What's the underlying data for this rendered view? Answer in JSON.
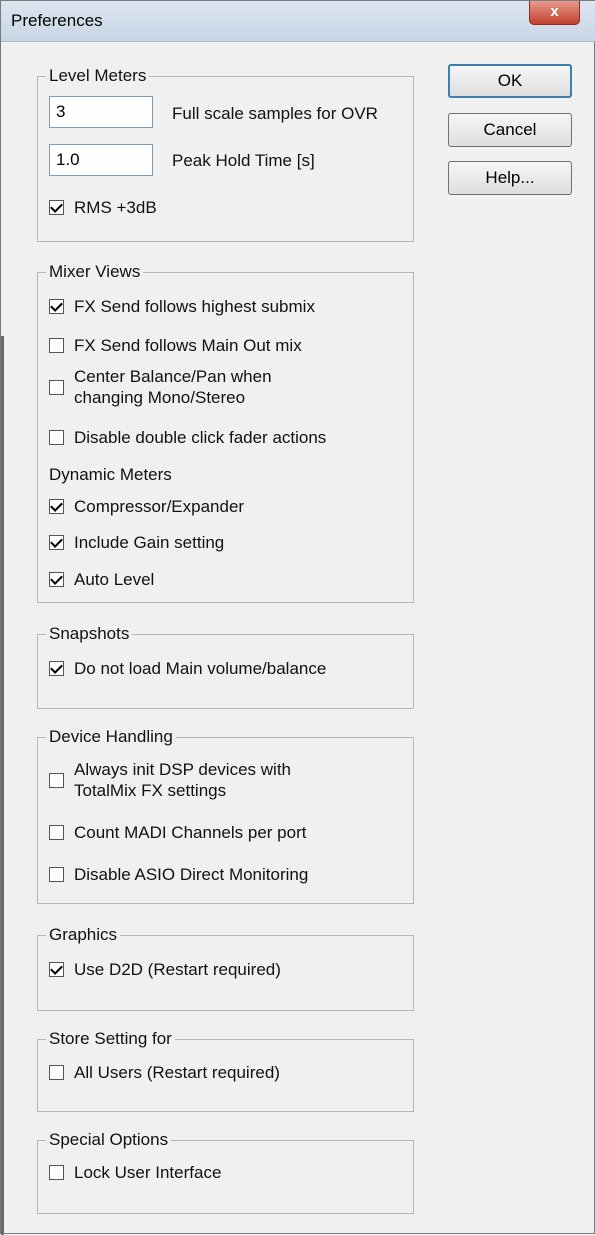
{
  "window": {
    "title": "Preferences",
    "close_symbol": "x"
  },
  "buttons": {
    "ok": "OK",
    "cancel": "Cancel",
    "help": "Help..."
  },
  "level_meters": {
    "legend": "Level Meters",
    "ovr_value": "3",
    "ovr_label": "Full scale samples for OVR",
    "peak_value": "1.0",
    "peak_label": "Peak Hold Time [s]",
    "rms_label": "RMS +3dB",
    "rms_checked": true
  },
  "mixer_views": {
    "legend": "Mixer Views",
    "items": [
      {
        "label": "FX Send follows highest submix",
        "checked": true
      },
      {
        "label": "FX Send follows Main Out mix",
        "checked": false
      },
      {
        "label": "Center Balance/Pan when changing Mono/Stereo",
        "checked": false
      },
      {
        "label": "Disable double click fader actions",
        "checked": false
      }
    ],
    "dynamic_meters_label": "Dynamic Meters",
    "dynamic_items": [
      {
        "label": "Compressor/Expander",
        "checked": true
      },
      {
        "label": "Include Gain setting",
        "checked": true
      },
      {
        "label": "Auto Level",
        "checked": true
      }
    ]
  },
  "snapshots": {
    "legend": "Snapshots",
    "items": [
      {
        "label": "Do not load Main volume/balance",
        "checked": true
      }
    ]
  },
  "device_handling": {
    "legend": "Device Handling",
    "items": [
      {
        "label": "Always init DSP devices with TotalMix FX settings",
        "checked": false
      },
      {
        "label": "Count MADI Channels per port",
        "checked": false
      },
      {
        "label": "Disable ASIO Direct Monitoring",
        "checked": false
      }
    ]
  },
  "graphics": {
    "legend": "Graphics",
    "items": [
      {
        "label": "Use D2D (Restart required)",
        "checked": true
      }
    ]
  },
  "store_setting": {
    "legend": "Store Setting for",
    "items": [
      {
        "label": "All Users (Restart required)",
        "checked": false
      }
    ]
  },
  "special_options": {
    "legend": "Special Options",
    "items": [
      {
        "label": "Lock User Interface",
        "checked": false
      }
    ]
  }
}
